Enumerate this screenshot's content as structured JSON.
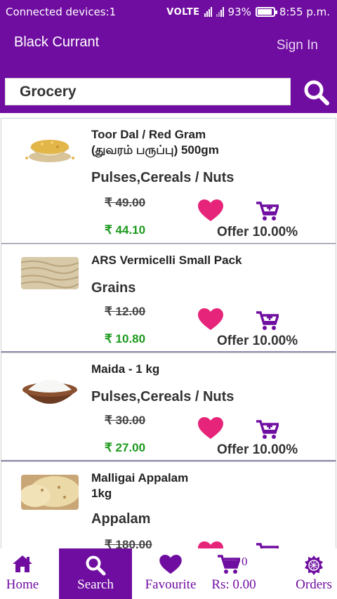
{
  "status_bar": {
    "left_text": "Connected devices:1",
    "network": "VOLTE",
    "battery": "93%",
    "time": "8:55 p.m."
  },
  "app_bar": {
    "title": "Black Currant",
    "sign_in": "Sign In"
  },
  "search": {
    "value": "Grocery",
    "placeholder": ""
  },
  "products": [
    {
      "name_line1": "Toor Dal / Red Gram",
      "name_line2": "(துவரம் பருப்பு) 500gm",
      "category": "Pulses,Cereals / Nuts",
      "old_price": "₹ 49.00",
      "new_price": "₹ 44.10",
      "offer": "Offer 10.00%"
    },
    {
      "name_line1": "ARS Vermicelli Small Pack",
      "name_line2": "",
      "category": "Grains",
      "old_price": "₹ 12.00",
      "new_price": "₹ 10.80",
      "offer": "Offer 10.00%"
    },
    {
      "name_line1": "Maida - 1 kg",
      "name_line2": "",
      "category": "Pulses,Cereals / Nuts",
      "old_price": "₹ 30.00",
      "new_price": "₹ 27.00",
      "offer": "Offer 10.00%"
    },
    {
      "name_line1": "Malligai Appalam",
      "name_line2": "1kg",
      "category": "Appalam",
      "old_price": "₹ 180.00",
      "new_price": "",
      "offer": ""
    }
  ],
  "bottom_nav": {
    "home": "Home",
    "search": "Search",
    "favourite": "Favourite",
    "cart_total": "Rs: 0.00",
    "cart_count": "0",
    "orders": "Orders"
  },
  "colors": {
    "primary": "#6f0da0",
    "heart": "#e6247a",
    "price_green": "#1e9a1e"
  }
}
